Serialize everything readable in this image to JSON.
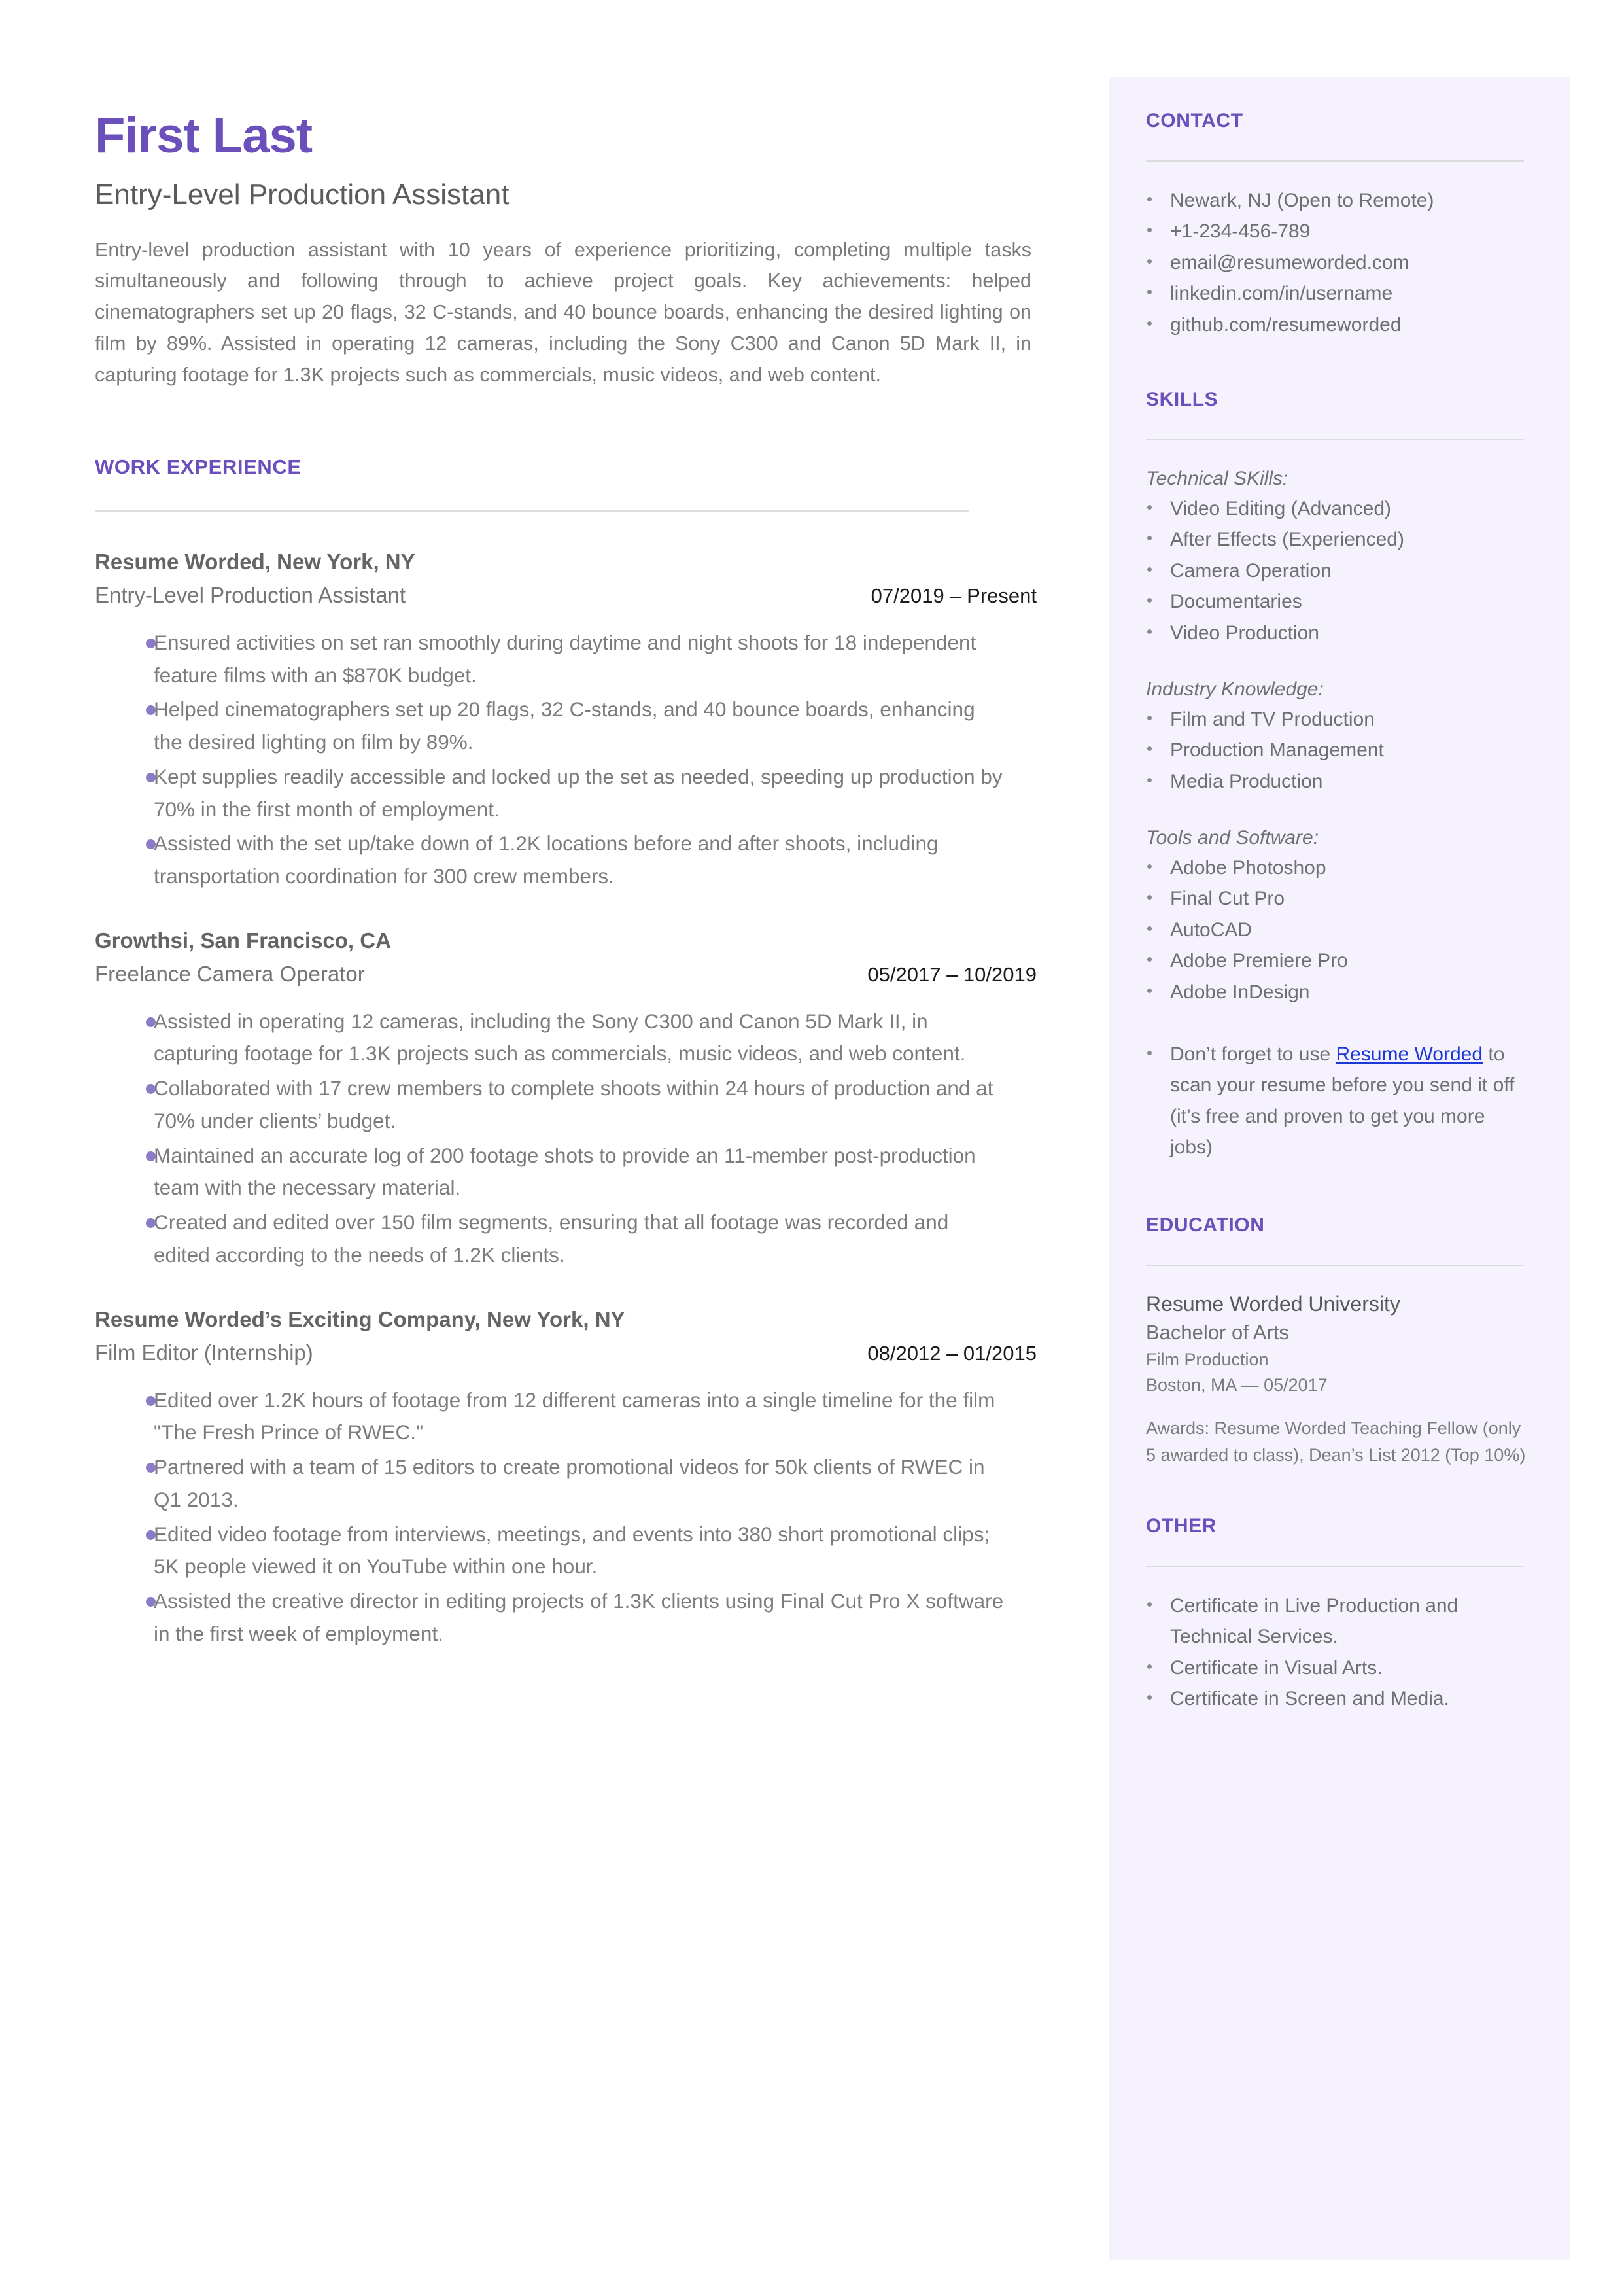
{
  "theme": {
    "accent": "#6b4fbb",
    "sidebar_bg": "#f5f2fd",
    "body_text": "#7a7a7a",
    "heading_text": "#646464",
    "link": "#1a39d6",
    "bullet": "#8b7bc4"
  },
  "header": {
    "name": "First Last",
    "headline": "Entry-Level Production Assistant",
    "summary": "Entry-level production assistant with 10 years of experience prioritizing, completing multiple tasks simultaneously and following through to achieve project goals. Key achievements: helped cinematographers set up 20 flags, 32 C-stands, and 40 bounce boards, enhancing the desired lighting on film by 89%. Assisted in operating 12 cameras, including the Sony C300 and Canon 5D Mark II, in capturing footage for 1.3K projects such as commercials, music videos, and web content."
  },
  "work_experience": {
    "heading": "WORK EXPERIENCE",
    "jobs": [
      {
        "company": "Resume Worded, New York, NY",
        "title": "Entry-Level Production Assistant",
        "dates": "07/2019 – Present",
        "bullets": [
          "Ensured activities on set ran smoothly during daytime and night shoots for 18 independent feature films with an $870K budget.",
          "Helped cinematographers set up 20 flags, 32 C-stands, and 40 bounce boards, enhancing the desired lighting on film by 89%.",
          "Kept supplies readily accessible and locked up the set as needed, speeding up production by 70% in the first month of employment.",
          "Assisted with the set up/take down of 1.2K locations before and after shoots, including transportation coordination for 300 crew members."
        ]
      },
      {
        "company": "Growthsi, San Francisco, CA",
        "title": "Freelance Camera Operator",
        "dates": "05/2017 – 10/2019",
        "bullets": [
          "Assisted in operating 12 cameras, including the Sony C300 and Canon 5D Mark II, in capturing footage for 1.3K projects such as commercials, music videos, and web content.",
          "Collaborated with 17 crew members to complete shoots within 24 hours of production and at 70% under clients’ budget.",
          "Maintained an accurate log of 200 footage shots to provide an 11-member post-production team with the necessary material.",
          "Created and edited over 150 film segments, ensuring that all footage was recorded and edited according to the needs of 1.2K clients."
        ]
      },
      {
        "company": "Resume Worded’s Exciting Company, New York, NY",
        "title": "Film Editor (Internship)",
        "dates": "08/2012 – 01/2015",
        "bullets": [
          "Edited over 1.2K hours of footage from 12 different cameras into a single timeline for the film \"The Fresh Prince of RWEC.\"",
          "Partnered with a team of 15 editors to create promotional videos for 50k clients of RWEC in Q1 2013.",
          "Edited video footage from interviews, meetings, and events into 380 short promotional clips; 5K people viewed it on YouTube within one hour.",
          "Assisted the creative director in editing projects of 1.3K clients using Final Cut Pro X software in the first week of employment."
        ]
      }
    ]
  },
  "contact": {
    "heading": "CONTACT",
    "items": [
      "Newark, NJ (Open to Remote)",
      "+1-234-456-789",
      "email@resumeworded.com",
      "linkedin.com/in/username",
      "github.com/resumeworded"
    ]
  },
  "skills": {
    "heading": "SKILLS",
    "groups": [
      {
        "label": "Technical SKills:",
        "items": [
          "Video Editing (Advanced)",
          "After Effects (Experienced)",
          "Camera Operation",
          "Documentaries",
          "Video Production"
        ]
      },
      {
        "label": "Industry Knowledge:",
        "items": [
          "Film and TV Production",
          "Production Management",
          "Media Production"
        ]
      },
      {
        "label": "Tools and Software:",
        "items": [
          "Adobe Photoshop",
          "Final Cut Pro",
          "AutoCAD",
          "Adobe Premiere Pro",
          "Adobe InDesign"
        ]
      }
    ],
    "promo": {
      "before": "Don’t forget to use ",
      "link_text": "Resume Worded",
      "after": " to scan your resume before you send it off (it’s free and proven to get you more jobs)"
    }
  },
  "education": {
    "heading": "EDUCATION",
    "school": "Resume Worded University",
    "degree": "Bachelor of Arts",
    "field": "Film Production",
    "location_date": "Boston, MA — 05/2017",
    "awards": "Awards: Resume Worded Teaching Fellow (only 5 awarded to class), Dean’s List 2012 (Top 10%)"
  },
  "other": {
    "heading": "OTHER",
    "items": [
      "Certificate in Live Production and Technical Services.",
      "Certificate in Visual Arts.",
      "Certificate in Screen and Media."
    ]
  }
}
